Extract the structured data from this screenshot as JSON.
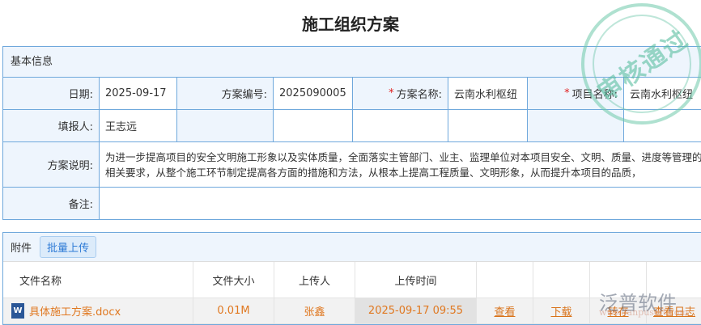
{
  "title": "施工组织方案",
  "section": "基本信息",
  "fields": {
    "date_label": "日期:",
    "date": "2025-09-17",
    "no_label": "方案编号:",
    "no": "2025090005",
    "name_label": "方案名称:",
    "name": "云南水利枢纽",
    "project_label": "项目名称:",
    "project": "云南水利枢纽",
    "reporter_label": "填报人:",
    "reporter": "王志远",
    "desc_label": "方案说明:",
    "desc": "为进一步提高项目的安全文明施工形象以及实体质量，全面落实主管部门、业主、监理单位对本项目安全、文明、质量、进度等管理的相关要求，从整个施工环节制定提高各方面的措施和方法，从根本上提高工程质量、文明形象，从而提升本项目的品质，",
    "remark_label": "备注:",
    "required_mark": "*"
  },
  "attachments": {
    "label": "附件",
    "upload_button": "批量上传",
    "headers": [
      "文件名称",
      "文件大小",
      "上传人",
      "上传时间"
    ],
    "rows": [
      {
        "name": "具体施工方案.docx",
        "size": "0.01M",
        "uploader": "张鑫",
        "time": "2025-09-17 09:55",
        "view": "查看",
        "download": "下载",
        "save": "转存",
        "log": "查看日志"
      }
    ]
  },
  "stamp": "审核通过",
  "watermark": {
    "brand": "泛普软件",
    "url": "www.fanpusoft.com"
  }
}
